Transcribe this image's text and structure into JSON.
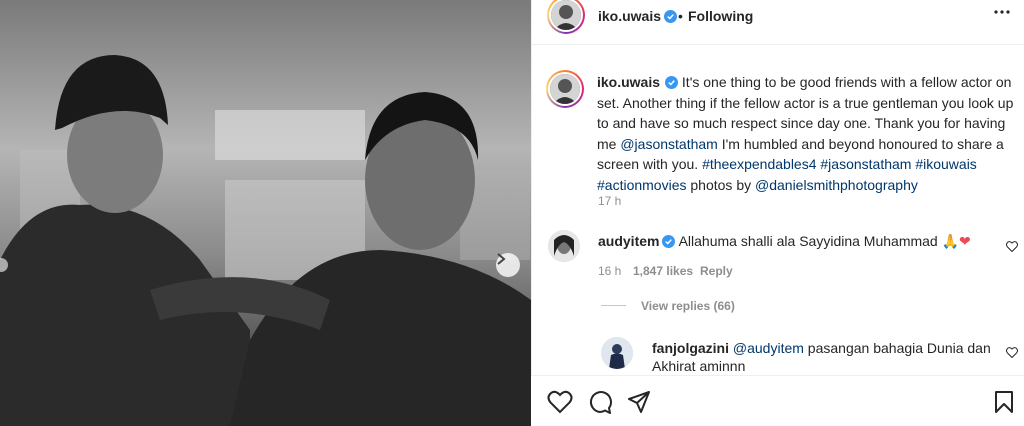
{
  "post": {
    "username": "iko.uwais",
    "bullet": "•",
    "follow_status": "Following",
    "more_icon": "ellipsis-icon"
  },
  "caption": {
    "username": "iko.uwais",
    "text_1": " It's one thing to be good friends with a fellow actor on set. Another thing if the fellow actor is a true gentleman you look up to and have so much respect since day one. Thank you for having me ",
    "mention_1": "@jasonstatham",
    "text_2": " I'm humbled and beyond honoured to share a screen with you. ",
    "hashtags": "#theexpendables4 #jasonstatham #ikouwais #actionmovies",
    "text_3": " photos by ",
    "mention_2": "@danielsmithphotography",
    "time": "17 h"
  },
  "comments": [
    {
      "username": "audyitem",
      "text": " Allahuma shalli ala Sayyidina Muhammad ",
      "emoji": "🙏❤",
      "time": "16 h",
      "likes": "1,847 likes",
      "reply": "Reply",
      "view_replies": "View replies (66)"
    },
    {
      "username": "fanjolgazini",
      "mention": "@audyitem",
      "text": " pasangan bahagia Dunia dan Akhirat aminnn"
    }
  ],
  "colors": {
    "link": "#00376b",
    "secondary": "#8e8e8e",
    "verified": "#3897f0",
    "heart": "#ed4956"
  }
}
